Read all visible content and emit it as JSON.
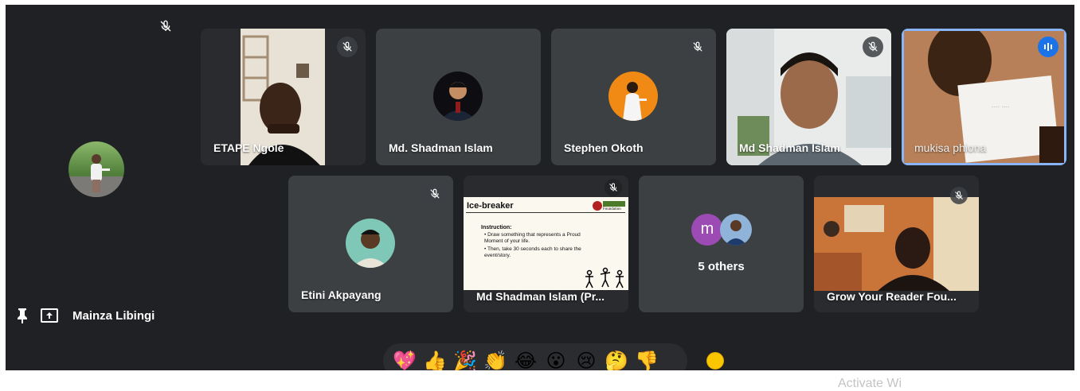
{
  "self": {
    "name": "Mainza Libingi"
  },
  "participants": [
    {
      "name": "ETAPE Ngole"
    },
    {
      "name": "Md. Shadman Islam"
    },
    {
      "name": "Stephen Okoth"
    },
    {
      "name": "Md Shadman Islam"
    },
    {
      "name": "mukisa phiona"
    },
    {
      "name": "Etini Akpayang"
    },
    {
      "name": "Md Shadman Islam (Pr..."
    },
    {
      "name": "Grow Your Reader Fou..."
    }
  ],
  "others": {
    "label": "5 others",
    "avatar_letter": "m"
  },
  "slide": {
    "title": "Ice-breaker",
    "heading": "Instruction:",
    "bullet_1": "Draw something that represents a Proud Moment of your life.",
    "bullet_2": "Then, take 30 seconds each to share the event/story.",
    "logo_text": "Foundation"
  },
  "reactions": [
    "💖",
    "👍",
    "🎉",
    "👏",
    "😂",
    "😮",
    "😢",
    "🤔",
    "👎"
  ],
  "watermark": "Activate Wi",
  "colors": {
    "background": "#202124",
    "tile": "#3c4043",
    "speaking": "#8ab4f8",
    "others_avatar": "#9c4bb5"
  }
}
